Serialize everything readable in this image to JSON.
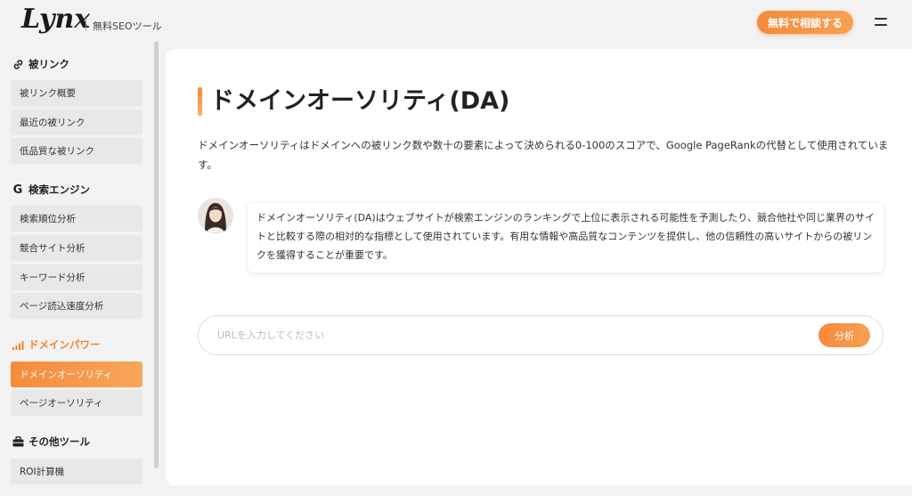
{
  "header": {
    "logo": "Lynx",
    "tagline": "無料SEOツール",
    "cta": "無料で相談する"
  },
  "sidebar": {
    "sections": [
      {
        "title": "被リンク",
        "icon": "link-icon",
        "items": [
          "被リンク概要",
          "最近の被リンク",
          "低品質な被リンク"
        ]
      },
      {
        "title": "検索エンジン",
        "icon": "google-icon",
        "items": [
          "検索順位分析",
          "競合サイト分析",
          "キーワード分析",
          "ページ読込速度分析"
        ]
      },
      {
        "title": "ドメインパワー",
        "icon": "signal-bars-icon",
        "items": [
          "ドメインオーソリティ",
          "ページオーソリティ"
        ]
      },
      {
        "title": "その他ツール",
        "icon": "toolbox-icon",
        "items": [
          "ROI計算機"
        ]
      }
    ],
    "active_item": "ドメインオーソリティ"
  },
  "main": {
    "title": "ドメインオーソリティ(DA)",
    "intro": "ドメインオーソリティはドメインへの被リンク数や数十の要素によって決められる0-100のスコアで、Google PageRankの代替として使用されています。",
    "bubble": "ドメインオーソリティ(DA)はウェブサイトが検索エンジンのランキングで上位に表示される可能性を予測したり、競合他社や同じ業界のサイトと比較する際の相対的な指標として使用されています。有用な情報や高品質なコンテンツを提供し、他の信頼性の高いサイトからの被リンクを獲得することが重要です。",
    "search_placeholder": "URLを入力してください",
    "search_value": "",
    "analyze": "分析"
  },
  "colors": {
    "accent": "#f58a3c",
    "accent_light": "#f7a152"
  }
}
